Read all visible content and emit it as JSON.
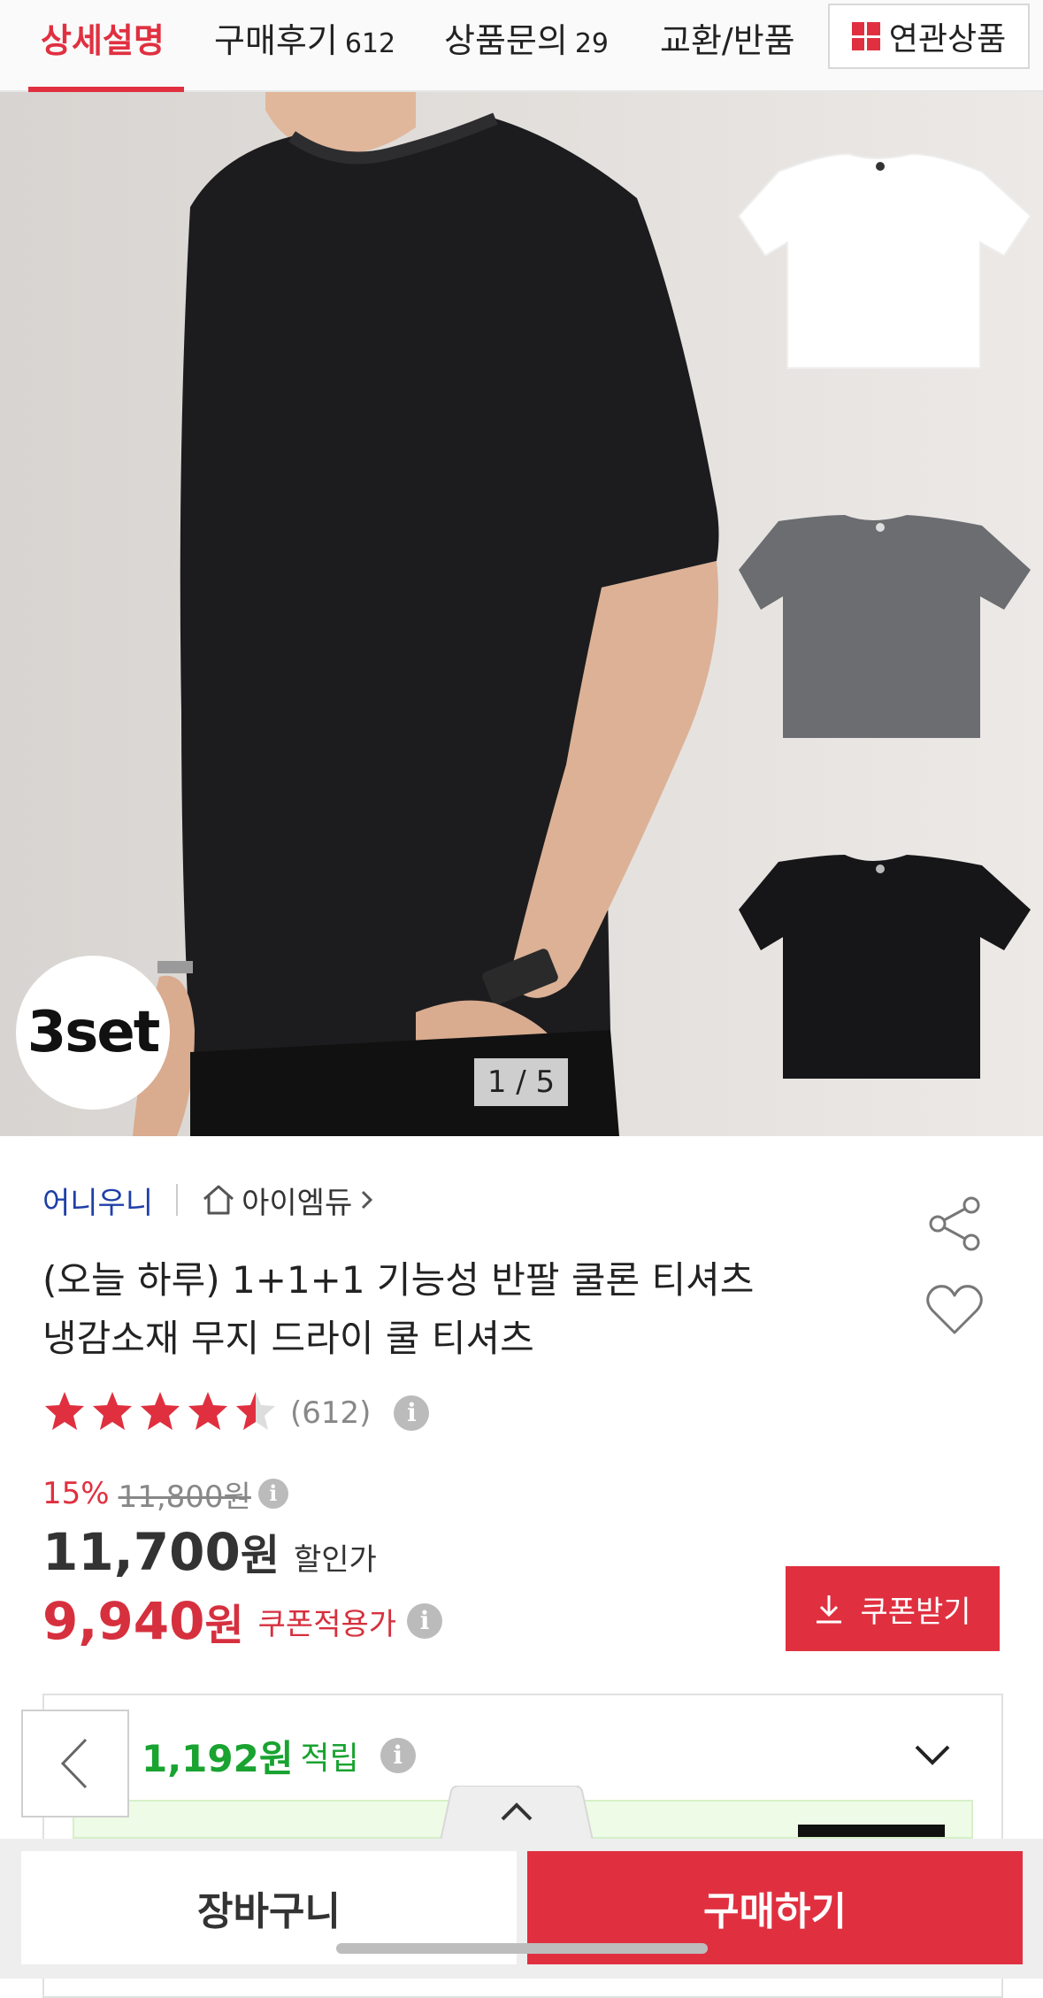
{
  "tabs": {
    "detail": "상세설명",
    "review": "구매후기",
    "review_count": "612",
    "qna": "상품문의",
    "qna_count": "29",
    "exchange": "교환/반품",
    "related": "연관상품"
  },
  "hero": {
    "badge": "3set",
    "counter": "1 / 5"
  },
  "seller": {
    "brand": "어니우니",
    "store": "아이엠듀"
  },
  "product": {
    "title_line1": "(오늘 하루) 1+1+1 기능성 반팔 쿨론 티셔츠",
    "title_line2": "냉감소재 무지 드라이 쿨 티셔츠"
  },
  "rating": {
    "stars": 4.5,
    "count": "(612)"
  },
  "price": {
    "discount_rate": "15%",
    "original": "11,800원",
    "sale_amount": "11,700",
    "sale_unit": "원",
    "sale_label": "할인가",
    "coupon_amount": "9,940",
    "coupon_unit": "원",
    "coupon_label": "쿠폰적용가"
  },
  "coupon_button": "쿠폰받기",
  "points": {
    "amount": "1,192원",
    "label": "적립"
  },
  "bottom": {
    "cart": "장바구니",
    "buy": "구매하기"
  },
  "colors": {
    "accent": "#e03040",
    "brand_link": "#1f3fa8",
    "points_green": "#19a330"
  },
  "icons": [
    "grid-icon",
    "home-icon",
    "chevron-right-icon",
    "share-icon",
    "heart-icon",
    "star-icon",
    "info-icon",
    "download-icon",
    "chevron-down-icon",
    "chevron-left-icon",
    "chevron-up-icon"
  ]
}
